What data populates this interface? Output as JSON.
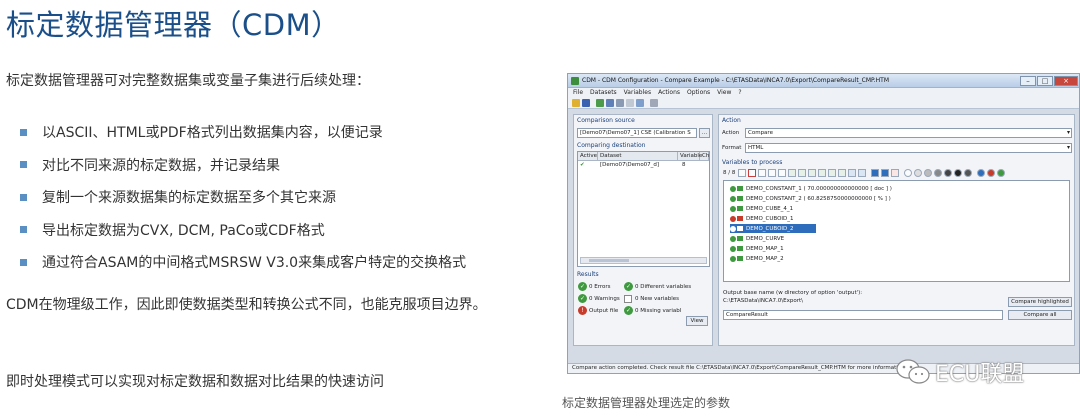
{
  "article": {
    "title": "标定数据管理器（CDM）",
    "intro": "标定数据管理器可对完整数据集或变量子集进行后续处理：",
    "bullets": [
      "以ASCII、HTML或PDF格式列出数据集内容，以便记录",
      "对比不同来源的标定数据，并记录结果",
      "复制一个来源数据集的标定数据至多个其它来源",
      "导出标定数据为CVX, DCM, PaCo或CDF格式",
      "通过符合ASAM的中间格式MSRSW V3.0来集成客户特定的交换格式"
    ],
    "para1": "CDM在物理级工作，因此即使数据类型和转换公式不同，也能克服项目边界。",
    "para2": "即时处理模式可以实现对标定数据和数据对比结果的快速访问"
  },
  "caption": "标定数据管理器处理选定的参数",
  "watermark": "ECU联盟",
  "window": {
    "title": "CDM - CDM Configuration - Compare Example - C:\\ETASData\\INCA7.0\\Export\\CompareResult_CMP.HTM",
    "menu": [
      "File",
      "Datasets",
      "Variables",
      "Actions",
      "Options",
      "View",
      "?"
    ],
    "comparison_source_label": "Comparison source",
    "comparison_source_value": "[Demo07\\Demo07_1] CSE (Calibration S",
    "browse": "...",
    "comparing_destination_label": "Comparing destination",
    "dest_columns": [
      "Active",
      "Dataset",
      "Variable",
      "Ch"
    ],
    "dest_rows": [
      {
        "dataset": "[Demo07\\Demo07_d]",
        "variable": "8"
      }
    ],
    "results_label": "Results",
    "results": {
      "errors": "0 Errors",
      "warnings": "0 Warnings",
      "output_file": "Output file",
      "different": "0 Different variables",
      "new": "0 New variables",
      "missing": "0 Missing variabl",
      "view": "View"
    },
    "action_label": "Action",
    "action_field_label": "Action",
    "action_value": "Compare",
    "format_label": "Format",
    "format_value": "HTML",
    "variables_label": "Variables to process",
    "variables_count": "8 / 8",
    "variables": [
      "DEMO_CONSTANT_1  ( 70.000000000000000 [ doc ] )",
      "DEMO_CONSTANT_2  ( 60.8258750000000000 [ % ] )",
      "DEMO_CUBE_4_1",
      "DEMO_CUBOID_1",
      "DEMO_CUBOID_2",
      "DEMO_CURVE",
      "DEMO_MAP_1",
      "DEMO_MAP_2"
    ],
    "selected_variable_index": 4,
    "output_base_label": "Output base name (w directory of option 'output'):",
    "output_dir": "C:\\ETASData\\INCA7.0\\Export\\",
    "output_name": "CompareResult",
    "compare_highlighted": "Compare highlighted",
    "compare_all": "Compare all",
    "status": "Compare action completed. Check result file C:\\ETASData\\INCA7.0\\Export\\CompareResult_CMP.HTM for more information."
  }
}
